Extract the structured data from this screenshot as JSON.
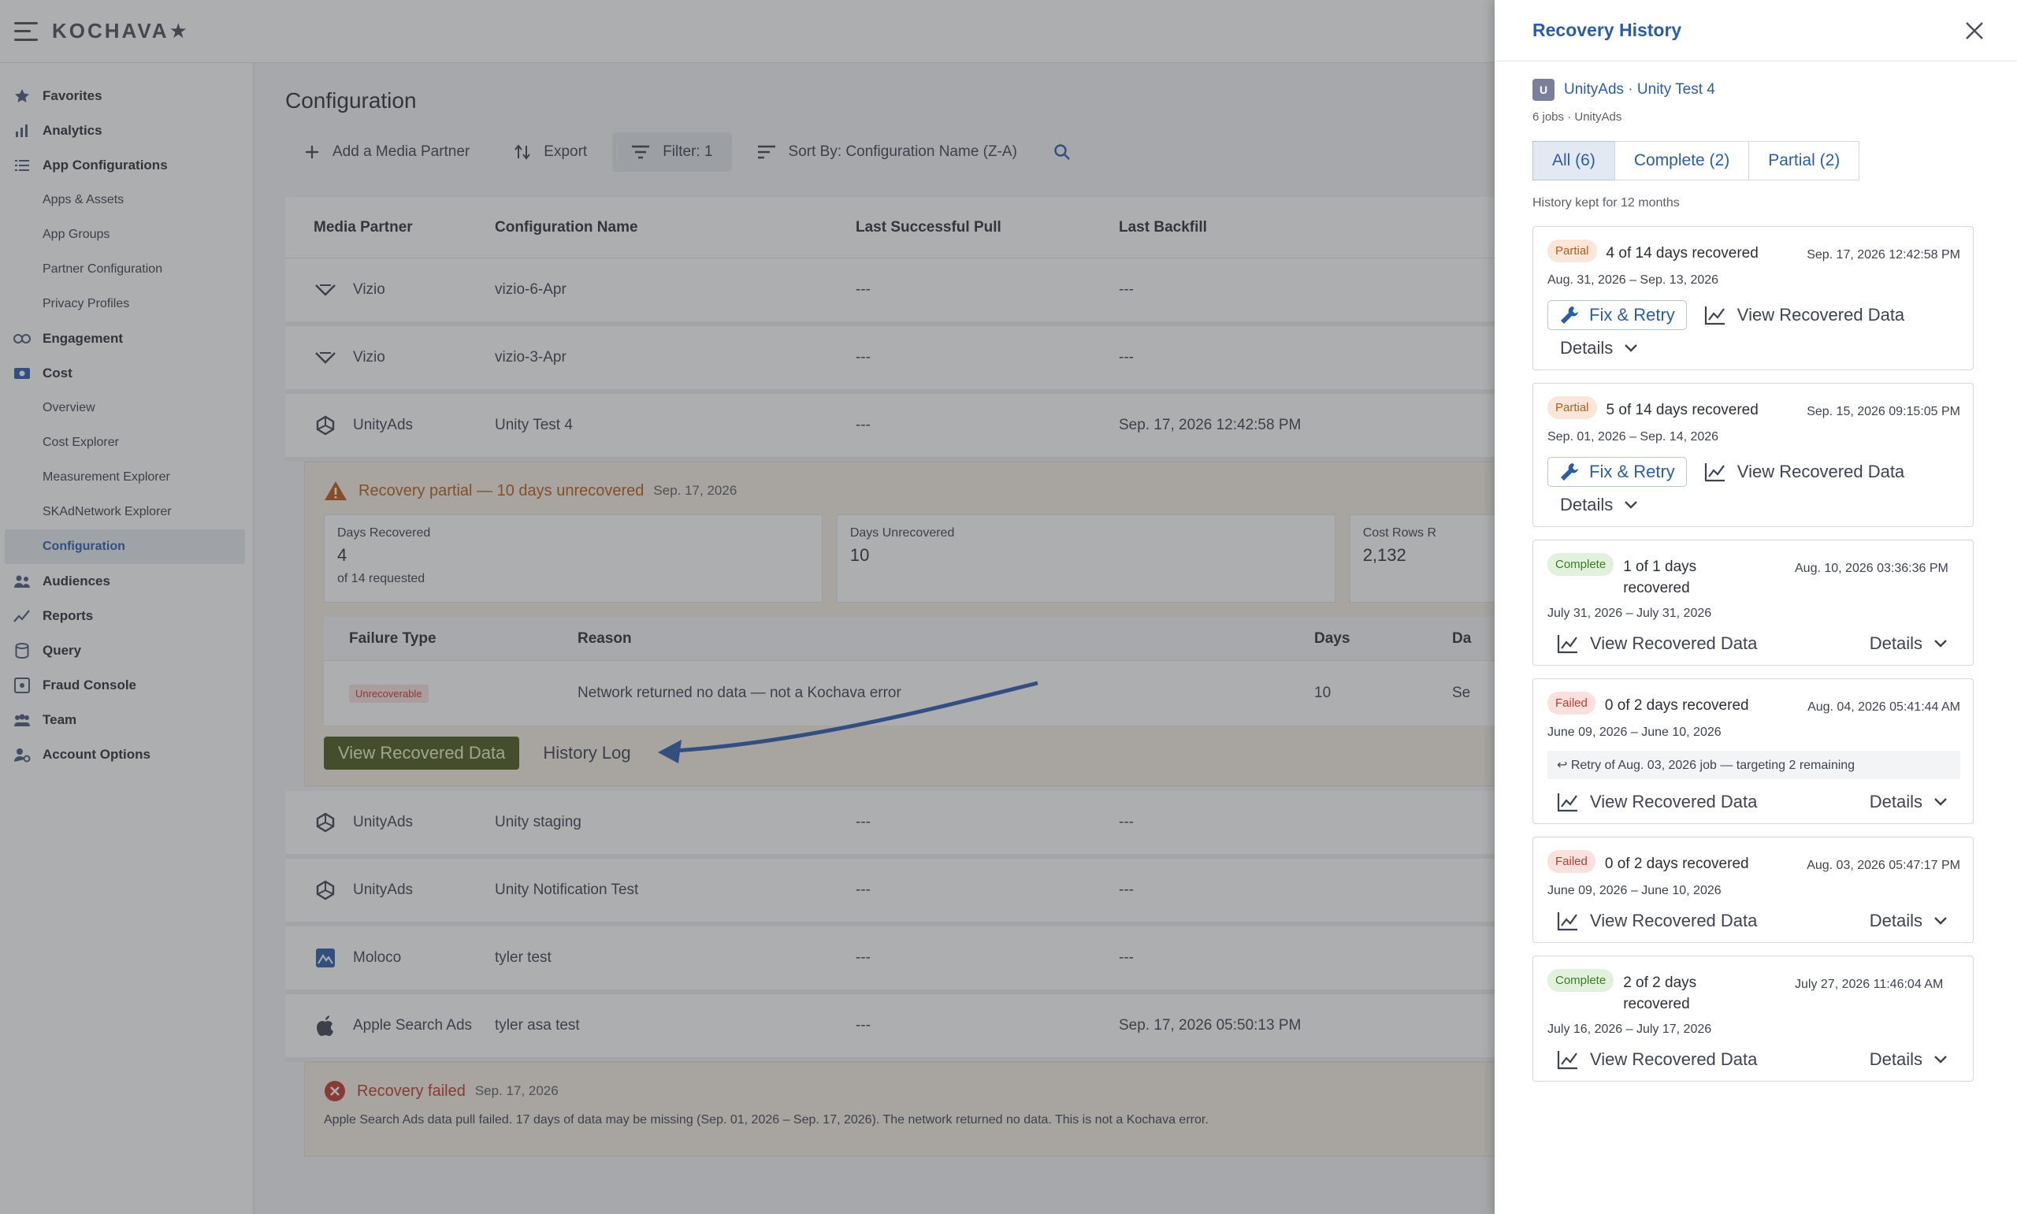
{
  "header": {
    "logo": "KOCHAVA★"
  },
  "sidebar": {
    "items": [
      {
        "label": "Favorites",
        "icon": "star-icon"
      },
      {
        "label": "Analytics",
        "icon": "bar-chart-icon"
      },
      {
        "label": "App Configurations",
        "icon": "list-icon"
      },
      {
        "label": "Apps & Assets",
        "sub": true
      },
      {
        "label": "App Groups",
        "sub": true
      },
      {
        "label": "Partner Configuration",
        "sub": true
      },
      {
        "label": "Privacy Profiles",
        "sub": true
      },
      {
        "label": "Engagement",
        "icon": "link-icon"
      },
      {
        "label": "Cost",
        "icon": "money-icon"
      },
      {
        "label": "Overview",
        "sub": true
      },
      {
        "label": "Cost Explorer",
        "sub": true
      },
      {
        "label": "Measurement Explorer",
        "sub": true
      },
      {
        "label": "SKAdNetwork Explorer",
        "sub": true
      },
      {
        "label": "Configuration",
        "sub": true,
        "active": true
      },
      {
        "label": "Audiences",
        "icon": "audience-icon"
      },
      {
        "label": "Reports",
        "icon": "trend-icon"
      },
      {
        "label": "Query",
        "icon": "database-icon"
      },
      {
        "label": "Fraud Console",
        "icon": "fraud-icon"
      },
      {
        "label": "Team",
        "icon": "team-icon"
      },
      {
        "label": "Account Options",
        "icon": "account-icon"
      }
    ]
  },
  "main": {
    "title": "Configuration",
    "toolbar": {
      "add": "Add a Media Partner",
      "export": "Export",
      "filter": "Filter:  1",
      "sort": "Sort  By: Configuration Name (Z-A)"
    },
    "columns": [
      "Media Partner",
      "Configuration Name",
      "Last Successful Pull",
      "Last Backfill"
    ],
    "rows_top": [
      {
        "partner": "Vizio",
        "icon": "vizio-icon",
        "config": "vizio-6-Apr",
        "pull": "---",
        "backfill": "---"
      },
      {
        "partner": "Vizio",
        "icon": "vizio-icon",
        "config": "vizio-3-Apr",
        "pull": "---",
        "backfill": "---"
      },
      {
        "partner": "UnityAds",
        "icon": "unity-icon",
        "config": "Unity Test 4",
        "pull": "---",
        "backfill": "Sep. 17, 2026 12:42:58 PM"
      }
    ],
    "expanded": {
      "title": "Recovery partial — 10 days unrecovered",
      "date": "Sep. 17, 2026",
      "stats": [
        {
          "label": "Days Recovered",
          "value": "4",
          "sub": "of 14 requested"
        },
        {
          "label": "Days Unrecovered",
          "value": "10",
          "sub": ""
        },
        {
          "label": "Cost Rows R",
          "value": "2,132",
          "sub": ""
        }
      ],
      "fail_columns": [
        "Failure Type",
        "Reason",
        "Days",
        "Da"
      ],
      "fail_row": {
        "type": "Unrecoverable",
        "reason": "Network returned no data — not a Kochava error",
        "days": "10",
        "extra": "Se"
      },
      "view_button": "View Recovered Data",
      "history_link": "History Log"
    },
    "rows_bottom": [
      {
        "partner": "UnityAds",
        "icon": "unity-icon",
        "config": "Unity staging",
        "pull": "---",
        "backfill": "---"
      },
      {
        "partner": "UnityAds",
        "icon": "unity-icon",
        "config": "Unity Notification Test",
        "pull": "---",
        "backfill": "---"
      },
      {
        "partner": "Moloco",
        "icon": "moloco-icon",
        "config": "tyler test",
        "pull": "---",
        "backfill": "---"
      },
      {
        "partner": "Apple Search Ads",
        "icon": "apple-icon",
        "config": "tyler asa test",
        "pull": "---",
        "backfill": "Sep. 17, 2026 05:50:13 PM"
      }
    ],
    "failed": {
      "title": "Recovery failed",
      "date": "Sep. 17, 2026",
      "text": "Apple Search Ads data pull failed. 17 days of data may be missing (Sep. 01, 2026 – Sep. 17, 2026). The network returned no data. This is not a Kochava error."
    }
  },
  "drawer": {
    "title": "Recovery History",
    "source_badge": "U",
    "source": "UnityAds · Unity Test 4",
    "source_sub": "6 jobs · UnityAds",
    "tabs": [
      "All (6)",
      "Complete (2)",
      "Partial (2)"
    ],
    "history_note": "History kept for 12 months",
    "fix_label": "Fix & Retry",
    "view_label": "View Recovered Data",
    "details_label": "Details",
    "cards": [
      {
        "status": "Partial",
        "summary": "4 of 14 days recovered",
        "stamp": "Sep. 17, 2026 12:42:58 PM",
        "range": "Aug. 31, 2026 – Sep. 13, 2026",
        "note": ""
      },
      {
        "status": "Partial",
        "summary": "5 of 14 days recovered",
        "stamp": "Sep. 15, 2026 09:15:05 PM",
        "range": "Sep. 01, 2026 – Sep. 14, 2026",
        "note": ""
      },
      {
        "status": "Complete",
        "summary": "1 of 1 days recovered",
        "stamp": "Aug. 10, 2026 03:36:36 PM",
        "range": "July 31, 2026 – July 31, 2026",
        "note": ""
      },
      {
        "status": "Failed",
        "summary": "0 of 2 days recovered",
        "stamp": "Aug. 04, 2026 05:41:44 AM",
        "range": "June 09, 2026 – June 10, 2026",
        "note": "↩ Retry of Aug. 03, 2026 job — targeting 2 remaining"
      },
      {
        "status": "Failed",
        "summary": "0 of 2 days recovered",
        "stamp": "Aug. 03, 2026 05:47:17 PM",
        "range": "June 09, 2026 – June 10, 2026",
        "note": ""
      },
      {
        "status": "Complete",
        "summary": "2 of 2 days recovered",
        "stamp": "July 27, 2026 11:46:04 AM",
        "range": "July 16, 2026 – July 17, 2026",
        "note": ""
      }
    ]
  },
  "colors": {
    "accent": "#2b5cab",
    "partial": "#b95c14",
    "failed": "#c0392b",
    "complete": "#3c7a2b",
    "olive": "#4a5a1e"
  }
}
